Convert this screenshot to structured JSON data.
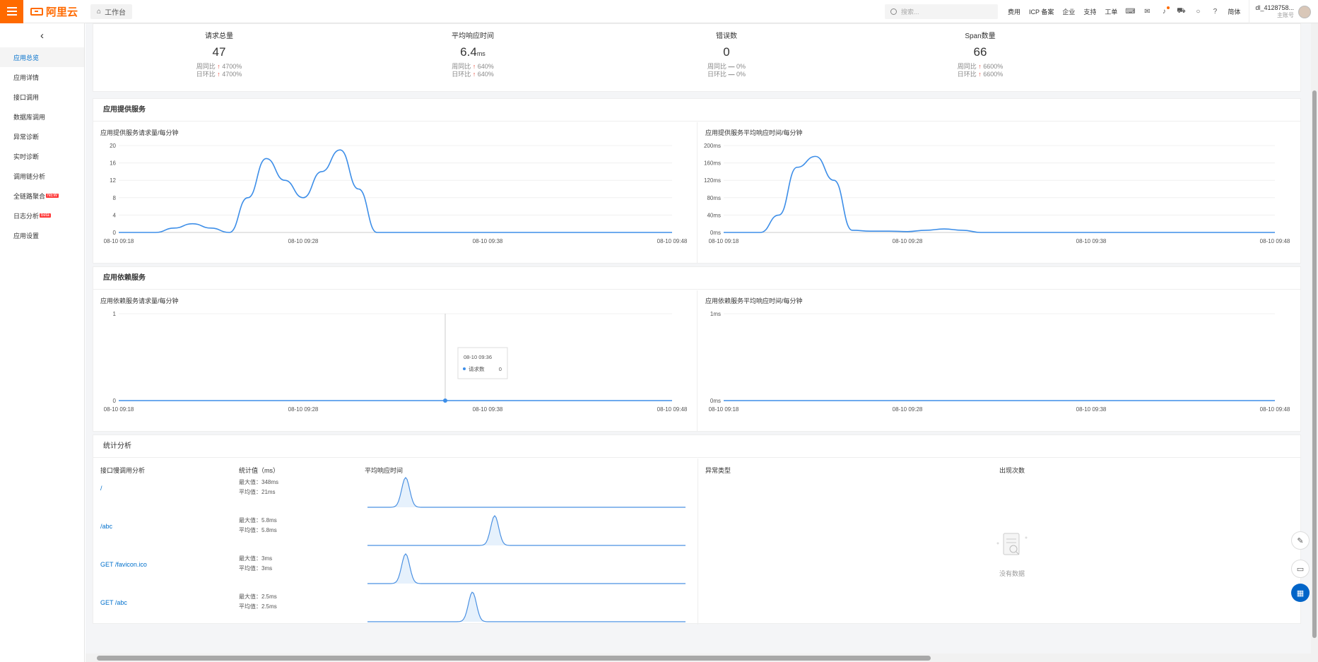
{
  "topbar": {
    "logo": "阿里云",
    "workbench": "工作台",
    "search_placeholder": "搜索...",
    "links": [
      "费用",
      "ICP 备案",
      "企业",
      "支持",
      "工单"
    ],
    "lang": "简体",
    "user_name": "dl_4128758...",
    "user_role": "主账号"
  },
  "sidebar": {
    "items": [
      {
        "label": "应用总览",
        "active": true
      },
      {
        "label": "应用详情"
      },
      {
        "label": "接口调用"
      },
      {
        "label": "数据库调用"
      },
      {
        "label": "异常诊断"
      },
      {
        "label": "实时诊断"
      },
      {
        "label": "调用链分析"
      },
      {
        "label": "全链路聚合",
        "badge": "NEW"
      },
      {
        "label": "日志分析",
        "badge": "beta"
      },
      {
        "label": "应用设置"
      }
    ]
  },
  "kpis": [
    {
      "label": "请求总量",
      "value": "47",
      "unit": "",
      "week": "周同比",
      "week_icon": "↑",
      "week_val": "4700%",
      "day": "日环比",
      "day_icon": "↑",
      "day_val": "4700%"
    },
    {
      "label": "平均响应时间",
      "value": "6.4",
      "unit": "ms",
      "week": "周同比",
      "week_icon": "↑",
      "week_val": "640%",
      "day": "日环比",
      "day_icon": "↑",
      "day_val": "640%"
    },
    {
      "label": "错误数",
      "value": "0",
      "unit": "",
      "week": "周同比",
      "week_icon": "—",
      "week_val": "0%",
      "day": "日环比",
      "day_icon": "—",
      "day_val": "0%"
    },
    {
      "label": "Span数量",
      "value": "66",
      "unit": "",
      "week": "周同比",
      "week_icon": "↑",
      "week_val": "6600%",
      "day": "日环比",
      "day_icon": "↑",
      "day_val": "6600%"
    }
  ],
  "sections": {
    "provide": "应用提供服务",
    "depend": "应用依赖服务",
    "stats": "统计分析"
  },
  "chart_data": [
    {
      "type": "line",
      "title": "应用提供服务请求量/每分钟",
      "x": [
        "08-10 09:18",
        "08-10 09:28",
        "08-10 09:38",
        "08-10 09:48"
      ],
      "yticks": [
        "0",
        "4",
        "8",
        "12",
        "16",
        "20"
      ],
      "ylim": [
        0,
        20
      ],
      "series": [
        {
          "values": [
            0,
            0,
            0,
            1,
            2,
            1,
            0,
            8,
            17,
            12,
            8,
            14,
            19,
            10,
            0,
            0,
            0,
            0,
            0,
            0,
            0,
            0,
            0,
            0,
            0,
            0,
            0,
            0,
            0,
            0,
            0
          ]
        }
      ]
    },
    {
      "type": "line",
      "title": "应用提供服务平均响应时间/每分钟",
      "x": [
        "08-10 09:18",
        "08-10 09:28",
        "08-10 09:38",
        "08-10 09:48"
      ],
      "yticks": [
        "0ms",
        "40ms",
        "80ms",
        "120ms",
        "160ms",
        "200ms"
      ],
      "ylim": [
        0,
        200
      ],
      "series": [
        {
          "values": [
            0,
            0,
            0,
            40,
            150,
            175,
            120,
            5,
            3,
            3,
            2,
            5,
            8,
            5,
            0,
            0,
            0,
            0,
            0,
            0,
            0,
            0,
            0,
            0,
            0,
            0,
            0,
            0,
            0,
            0,
            0
          ]
        }
      ]
    },
    {
      "type": "line",
      "title": "应用依赖服务请求量/每分钟",
      "x": [
        "08-10 09:18",
        "08-10 09:28",
        "08-10 09:38",
        "08-10 09:48"
      ],
      "yticks": [
        "0",
        "1"
      ],
      "ylim": [
        0,
        1
      ],
      "series": [
        {
          "name": "请求数",
          "values": [
            0,
            0,
            0,
            0,
            0,
            0,
            0,
            0,
            0,
            0,
            0,
            0,
            0,
            0,
            0,
            0,
            0,
            0,
            0,
            0,
            0,
            0,
            0,
            0,
            0,
            0,
            0,
            0,
            0,
            0,
            0
          ]
        }
      ],
      "tooltip": {
        "time": "08-10 09:36",
        "label": "请求数",
        "value": "0"
      }
    },
    {
      "type": "line",
      "title": "应用依赖服务平均响应时间/每分钟",
      "x": [
        "08-10 09:18",
        "08-10 09:28",
        "08-10 09:38",
        "08-10 09:48"
      ],
      "yticks": [
        "0ms",
        "1ms"
      ],
      "ylim": [
        0,
        1
      ],
      "series": [
        {
          "values": [
            0,
            0,
            0,
            0,
            0,
            0,
            0,
            0,
            0,
            0,
            0,
            0,
            0,
            0,
            0,
            0,
            0,
            0,
            0,
            0,
            0,
            0,
            0,
            0,
            0,
            0,
            0,
            0,
            0,
            0,
            0
          ]
        }
      ]
    }
  ],
  "stats": {
    "col_api": "接口慢调用分析",
    "col_stat": "统计值（ms）",
    "col_avg": "平均响应时间",
    "col_err": "异常类型",
    "col_count": "出现次数",
    "empty": "没有数据",
    "rows": [
      {
        "api": "/",
        "max": "最大值：348ms",
        "avg": "平均值：21ms",
        "peak": 0.12
      },
      {
        "api": "/abc",
        "max": "最大值：5.8ms",
        "avg": "平均值：5.8ms",
        "peak": 0.4
      },
      {
        "api": "GET /favicon.ico",
        "max": "最大值：3ms",
        "avg": "平均值：3ms",
        "peak": 0.12
      },
      {
        "api": "GET /abc",
        "max": "最大值：2.5ms",
        "avg": "平均值：2.5ms",
        "peak": 0.33
      }
    ]
  }
}
